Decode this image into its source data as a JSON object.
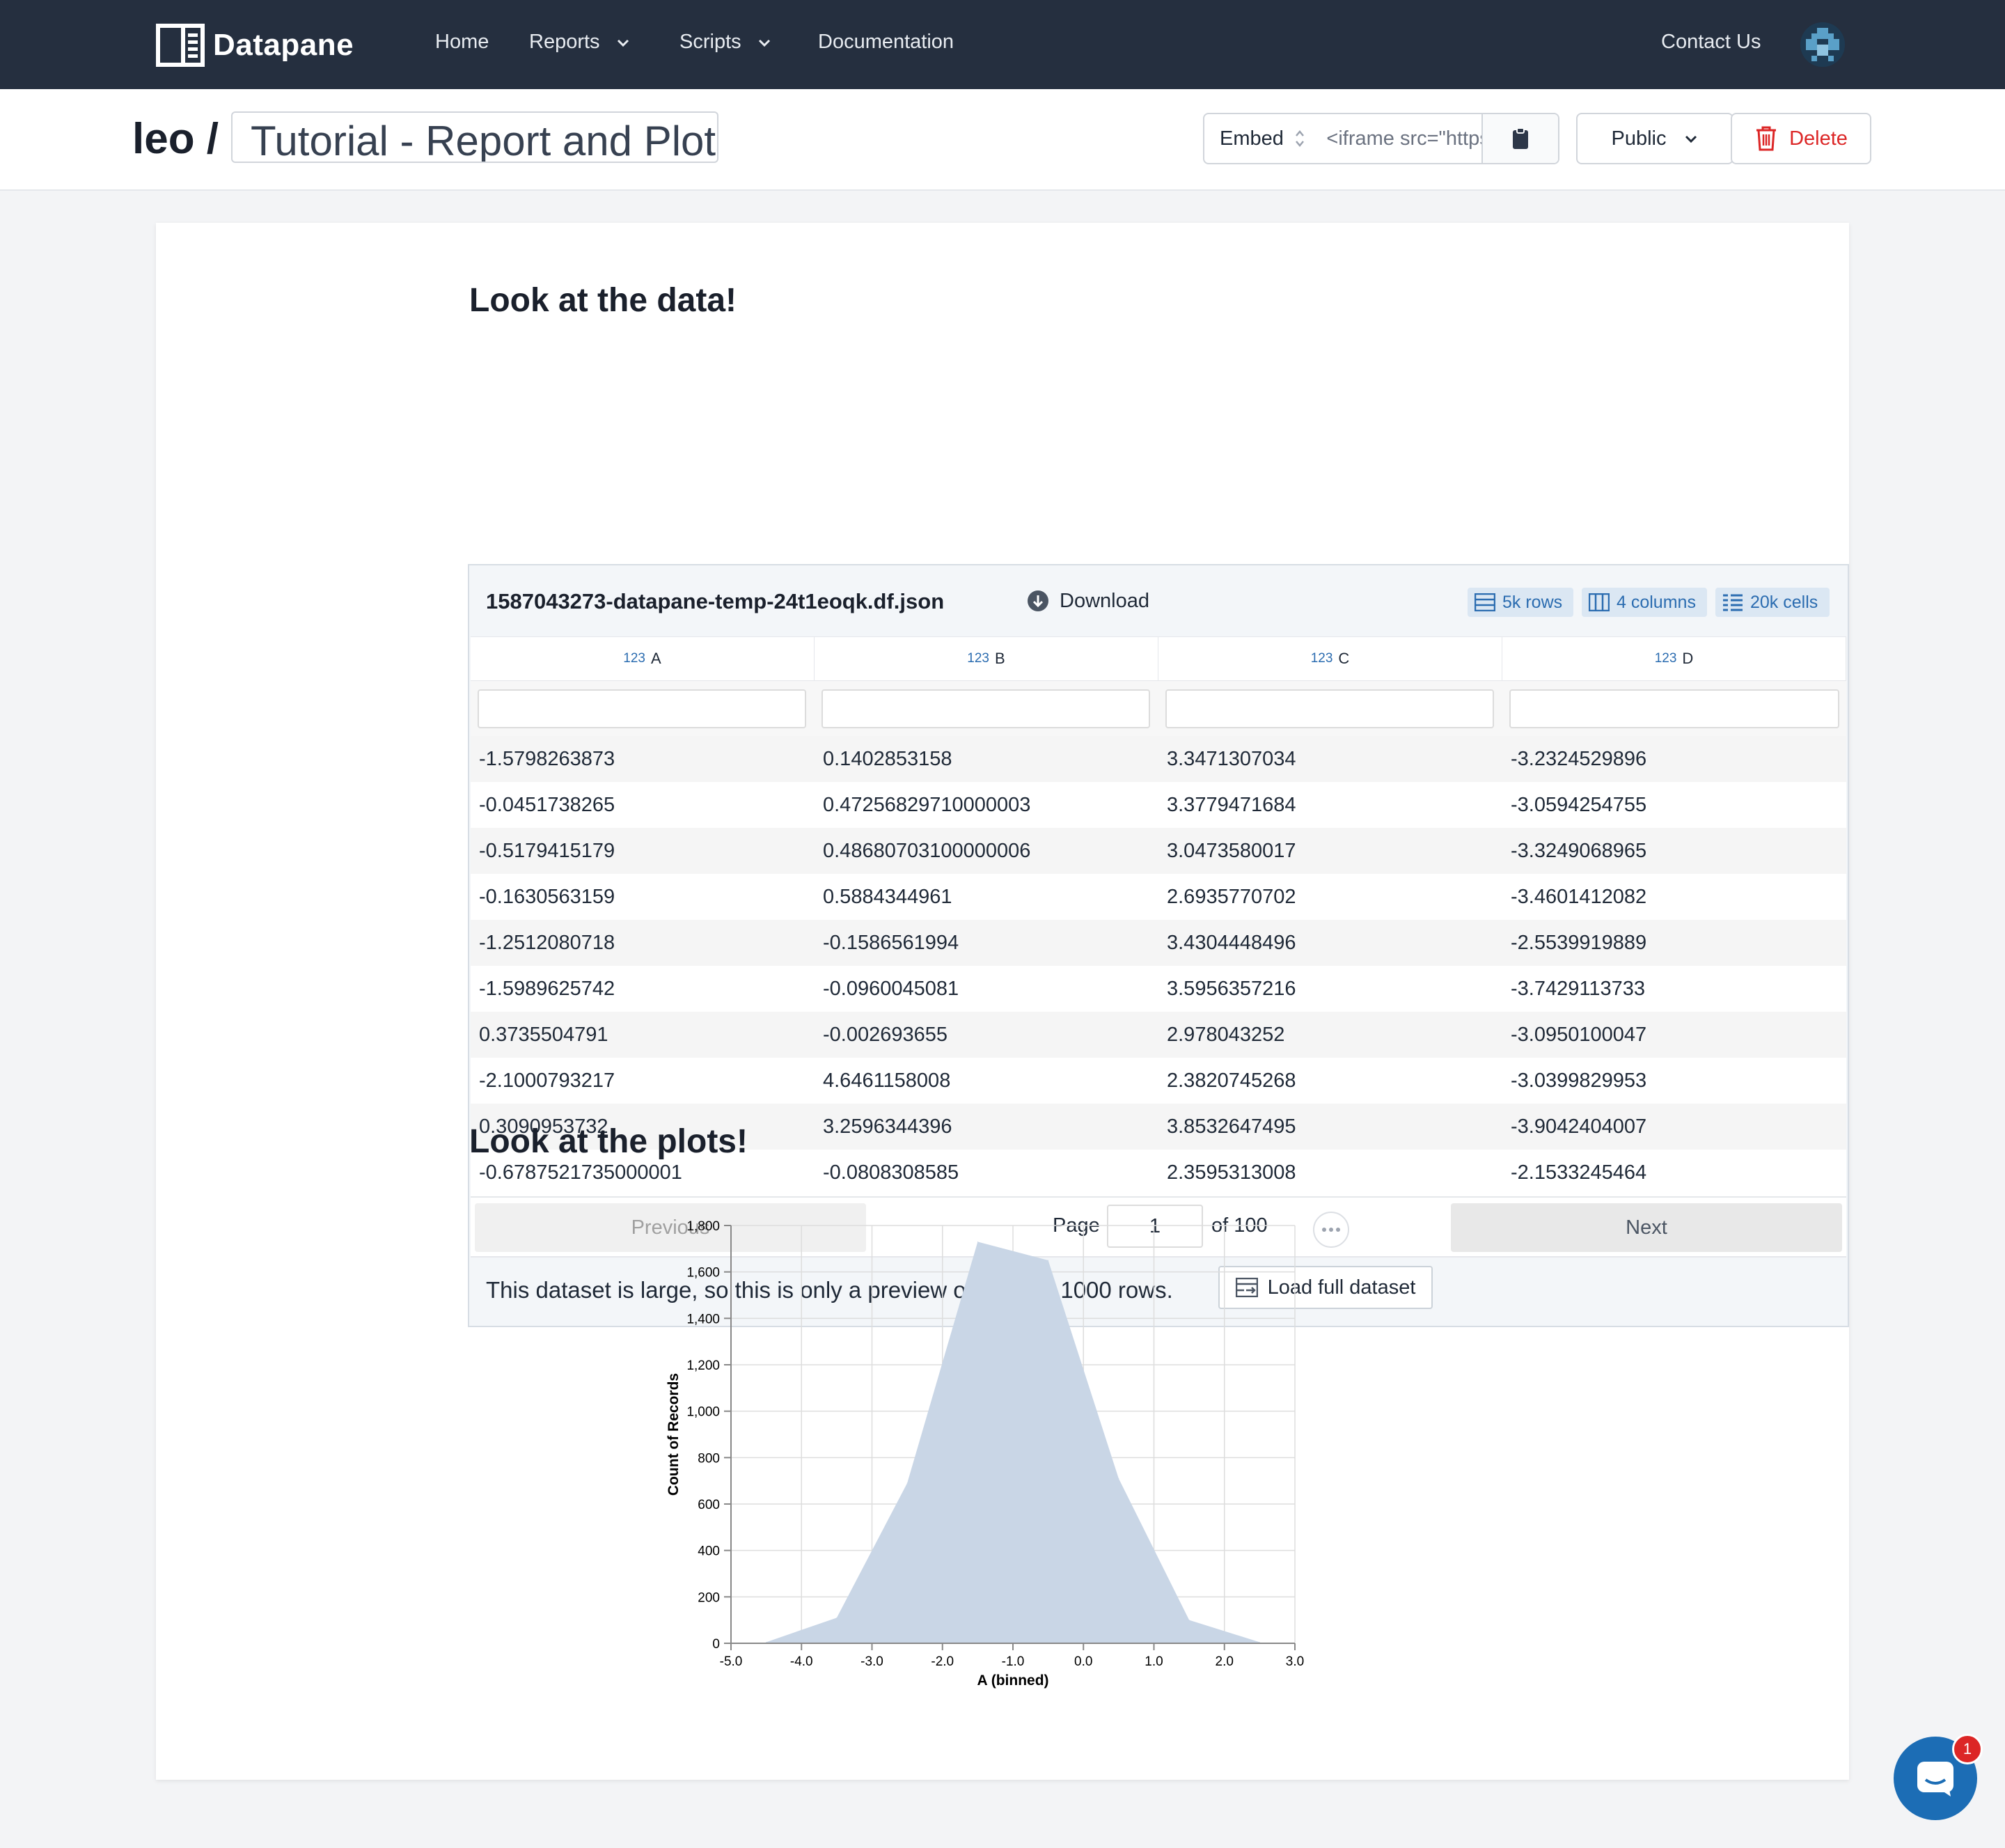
{
  "nav": {
    "brand": "Datapane",
    "links": [
      {
        "label": "Home"
      },
      {
        "label": "Reports"
      },
      {
        "label": "Scripts"
      },
      {
        "label": "Documentation"
      }
    ],
    "contact": "Contact Us"
  },
  "header": {
    "owner": "leo /",
    "title": "Tutorial - Report and Plots",
    "embed_label": "Embed",
    "embed_code": "<iframe src=\"https://datapane.com/leo/reports/tutorial",
    "visibility": "Public",
    "delete": "Delete"
  },
  "section1": {
    "heading": "Look at the data!"
  },
  "dataset": {
    "filename": "1587043273-datapane-temp-24t1eoqk.df.json",
    "download": "Download",
    "stats": {
      "rows": "5k rows",
      "columns": "4 columns",
      "cells": "20k cells"
    },
    "type_label": "123",
    "columns": [
      "A",
      "B",
      "C",
      "D"
    ],
    "rows": [
      [
        "-1.5798263873",
        "0.1402853158",
        "3.3471307034",
        "-3.2324529896"
      ],
      [
        "-0.0451738265",
        "0.47256829710000003",
        "3.3779471684",
        "-3.0594254755"
      ],
      [
        "-0.5179415179",
        "0.48680703100000006",
        "3.0473580017",
        "-3.3249068965"
      ],
      [
        "-0.1630563159",
        "0.5884344961",
        "2.6935770702",
        "-3.4601412082"
      ],
      [
        "-1.2512080718",
        "-0.1586561994",
        "3.4304448496",
        "-2.5539919889"
      ],
      [
        "-1.5989625742",
        "-0.0960045081",
        "3.5956357216",
        "-3.7429113733"
      ],
      [
        "0.3735504791",
        "-0.002693655",
        "2.978043252",
        "-3.0950100047"
      ],
      [
        "-2.1000793217",
        "4.6461158008",
        "2.3820745268",
        "-3.0399829953"
      ],
      [
        "0.3090953732",
        "3.2596344396",
        "3.8532647495",
        "-3.9042404007"
      ],
      [
        "-0.6787521735000001",
        "-0.0808308585",
        "2.3595313008",
        "-2.1533245464"
      ]
    ],
    "pager": {
      "previous": "Previous",
      "page_label": "Page",
      "page": "1",
      "of": "of 100",
      "next": "Next"
    },
    "notice": "This dataset is large, so this is only a preview of the first 1000 rows.",
    "load_full": "Load full dataset"
  },
  "section2": {
    "heading": "Look at the plots!"
  },
  "chart_data": {
    "type": "area",
    "xlabel": "A (binned)",
    "ylabel": "Count of Records",
    "xlim": [
      -5.0,
      3.0
    ],
    "ylim": [
      0,
      1800
    ],
    "x_ticks": [
      "-5.0",
      "-4.0",
      "-3.0",
      "-2.0",
      "-1.0",
      "0.0",
      "1.0",
      "2.0",
      "3.0"
    ],
    "y_ticks": [
      "0",
      "200",
      "400",
      "600",
      "800",
      "1,000",
      "1,200",
      "1,400",
      "1,600",
      "1,800"
    ],
    "x": [
      -4.5,
      -3.5,
      -2.5,
      -1.5,
      -0.5,
      0.5,
      1.5,
      2.5
    ],
    "values": [
      5,
      110,
      690,
      1730,
      1650,
      710,
      100,
      5
    ],
    "fill_color": "#c9d6e6",
    "grid": true
  },
  "chat": {
    "badge": "1"
  }
}
